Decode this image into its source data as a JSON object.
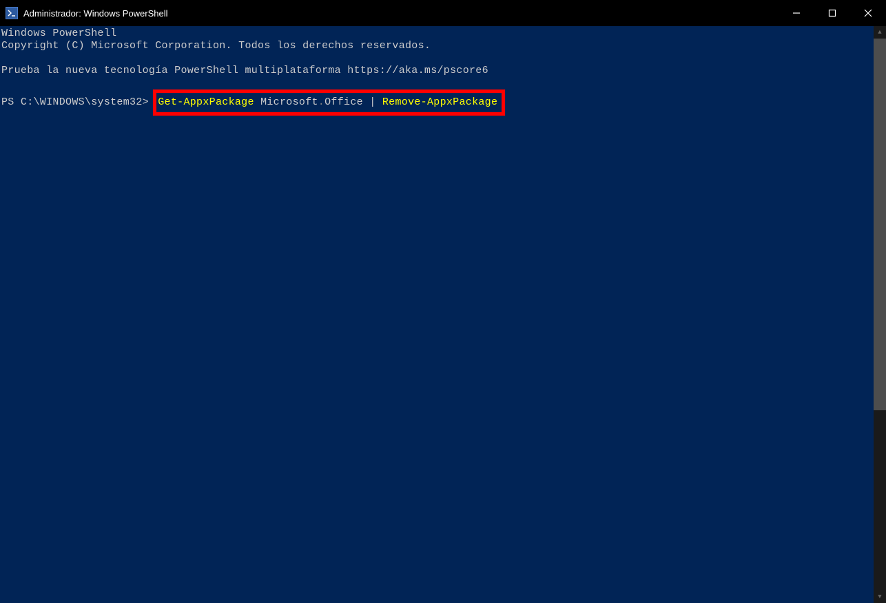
{
  "window": {
    "title": "Administrador: Windows PowerShell"
  },
  "output": {
    "header_line1": "Windows PowerShell",
    "header_line2": "Copyright (C) Microsoft Corporation. Todos los derechos reservados.",
    "promo_line": "Prueba la nueva tecnología PowerShell multiplataforma https://aka.ms/pscore6",
    "prompt_prefix": "PS C:\\WINDOWS\\system32> ",
    "cmd_get": "Get-AppxPackage",
    "cmd_arg1": " Microsoft",
    "cmd_arg_dot": ".",
    "cmd_arg2": "Office ",
    "cmd_pipe": "|",
    "cmd_space": " ",
    "cmd_remove": "Remove-AppxPackage"
  }
}
